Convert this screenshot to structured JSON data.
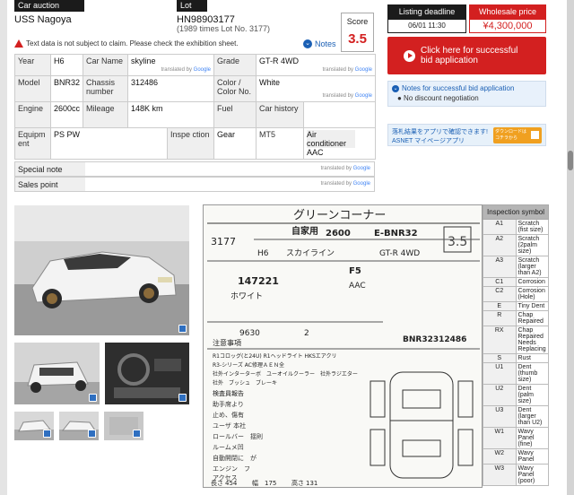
{
  "header": {
    "venue_label": "Car auction venue",
    "venue": "USS Nagoya",
    "lot_label": "Lot No.",
    "lot_no": "HN98903177",
    "lot_sub": "(1989 times Lot No. 3177)",
    "score_label": "Score",
    "score": "3.5"
  },
  "warning": "Text data is not subject to claim. Please check the exhibition sheet.",
  "notes_label": "Notes",
  "google": {
    "prefix": "translated by",
    "brand": "Google"
  },
  "specs": {
    "year_k": "Year",
    "year": "H6",
    "carname_k": "Car Name",
    "carname": "skyline",
    "grade_k": "Grade",
    "grade": "GT-R 4WD",
    "model_k": "Model",
    "model": "BNR32",
    "chassis_k": "Chassis number",
    "chassis": "312486",
    "color_k": "Color / Color No.",
    "color": "White",
    "engine_k": "Engine",
    "engine": "2600cc",
    "mileage_k": "Mileage",
    "mileage": "148K km",
    "fuel_k": "Fuel",
    "fuel": "",
    "history_k": "Car history",
    "history": "",
    "equip_k": "Equipm ent",
    "equip": "PS PW",
    "inspect_k": "Inspe ction",
    "inspect": "",
    "gear_k": "Gear",
    "gear": "MT5",
    "ac_k": "Air conditioner",
    "ac": "AAC"
  },
  "special_note_k": "Special note",
  "sales_point_k": "Sales point",
  "sidebar": {
    "deadline_label": "Listing deadline",
    "deadline": "06/01 11:30",
    "price_label": "Wholesale price",
    "price": "¥4,300,000",
    "bid_button": "Click here for successful bid application",
    "info_title": "Notes for successful bid application",
    "info_text": "● No discount negotiation",
    "banner_line1": "落札結果をアプリで確認できます!",
    "banner_line2": "ASNET マイページアプリ",
    "banner_btn": "ダウンロードはコチラから"
  },
  "sheet": {
    "title": "グリーンコーナー",
    "lot": "3177",
    "kind": "自家用",
    "cc": "2600",
    "model": "E-BNR32",
    "score": "3.5",
    "year": "H6",
    "name": "スカイライン",
    "grade": "GT-R 4WD",
    "km": "147221",
    "color": "ホワイト",
    "ac": "AAC",
    "shift": "F5",
    "tax": "9630",
    "seats": "2",
    "chassis": "BNR32312486",
    "notes_header": "注意事項",
    "inspection_header": "検査員報告",
    "lines": [
      "R1コロッグ(と24U) R1ヘッドライト HKSエアクリ",
      "R3-シリーズ AC修理ＡＥＮ全",
      "社外インターターボ　ユーオイルクーラー　社外ラジエター",
      "社外　ブッシュ　ブレーキ"
    ],
    "report": [
      "助手席より",
      "止め、傷有",
      "ユーザ 本社",
      "ロールバー　揺則",
      "ルームメ凹",
      "自動開閉に　が",
      "エンジン　フ",
      "アクセス"
    ],
    "bottom_labels": [
      "長さ",
      "幅",
      "高さ"
    ],
    "bottom_values": [
      "454",
      "175",
      "131"
    ]
  },
  "symbols": {
    "title": "Inspection symbol",
    "rows": [
      {
        "c": "A1",
        "d": "Scratch (fist size)"
      },
      {
        "c": "A2",
        "d": "Scratch (2palm size)"
      },
      {
        "c": "A3",
        "d": "Scratch (larger than A2)"
      },
      {
        "c": "C1",
        "d": "Corrosion"
      },
      {
        "c": "C2",
        "d": "Corrosion (Hole)"
      },
      {
        "c": "E",
        "d": "Tiny Dent"
      },
      {
        "c": "R",
        "d": "Chap Repaired"
      },
      {
        "c": "RX",
        "d": "Chap Repaired Needs Replacing"
      },
      {
        "c": "S",
        "d": "Rust"
      },
      {
        "c": "U1",
        "d": "Dent (thumb size)"
      },
      {
        "c": "U2",
        "d": "Dent (palm size)"
      },
      {
        "c": "U3",
        "d": "Dent (larger than U2)"
      },
      {
        "c": "W1",
        "d": "Wavy Panel (fine)"
      },
      {
        "c": "W2",
        "d": "Wavy Panel"
      },
      {
        "c": "W3",
        "d": "Wavy Panel (poor)"
      }
    ]
  },
  "colors": {
    "accent_red": "#d32020",
    "dark": "#1b1b1b",
    "link_blue": "#1a5fb4"
  }
}
